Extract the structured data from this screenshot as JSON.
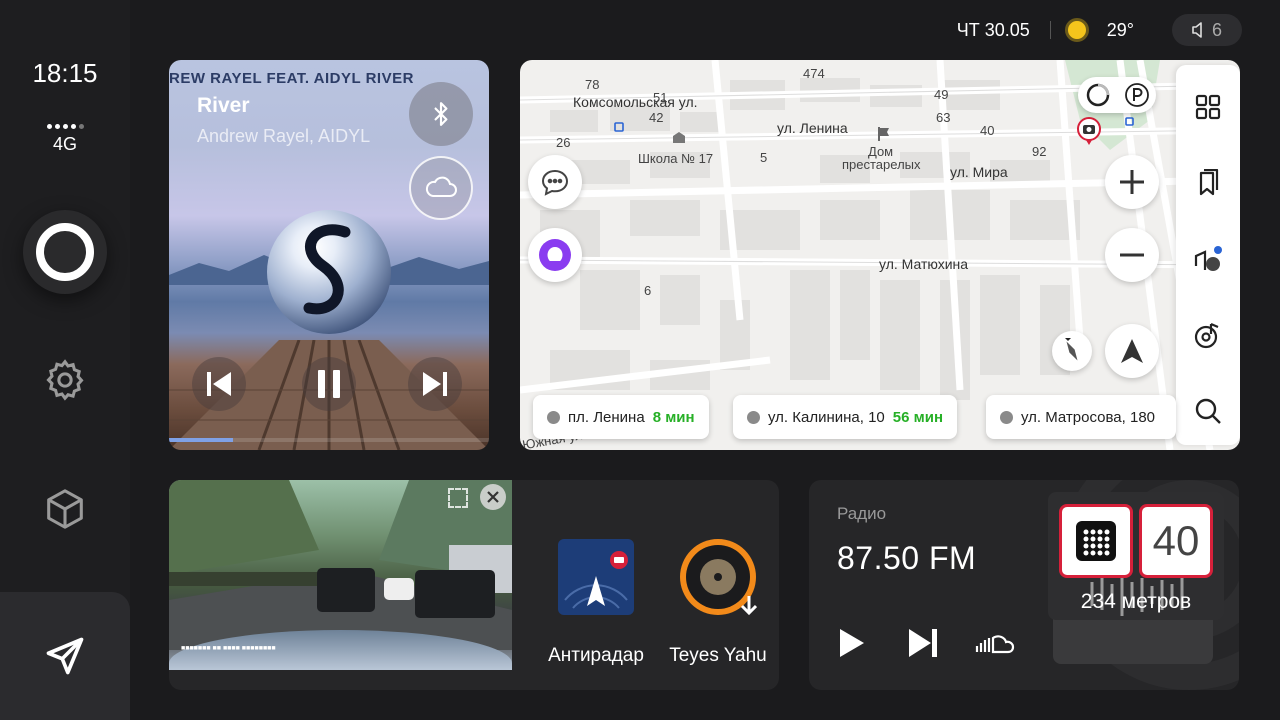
{
  "sidebar": {
    "time": "18:15",
    "network": "4G",
    "icons": [
      "assistant-icon",
      "gear-icon",
      "cube-icon",
      "navigation-arrow-icon"
    ]
  },
  "status_bar": {
    "date": "ЧТ 30.05",
    "weather_icon": "sun-icon",
    "temperature": "29°",
    "volume_level": "6"
  },
  "music": {
    "banner": "REW RAYEL FEAT. AIDYL  RIVER",
    "title": "River",
    "artist": "Andrew Rayel, AIDYL",
    "progress": 0.2,
    "buttons": [
      "bluetooth-icon",
      "cloud-icon",
      "previous-icon",
      "pause-icon",
      "next-icon"
    ]
  },
  "map": {
    "labels": {
      "street_komsomolskaya": "Комсомольская ул.",
      "street_lenina": "ул. Ленина",
      "street_mira": "ул. Мира",
      "street_matyukhina": "ул. Матюхина",
      "school": "Школа № 17",
      "home_line1": "Дом",
      "home_line2": "престарелых",
      "yuzhnaya": "Южная ул.",
      "n78": "78",
      "n51": "51",
      "n42": "42",
      "n26": "26",
      "n5": "5",
      "n6": "6",
      "n63": "63",
      "n40": "40",
      "n92": "92",
      "n49": "49",
      "n474": "474"
    },
    "routes": [
      {
        "place": "пл. Ленина",
        "eta": "8 мин"
      },
      {
        "place": "ул. Калинина, 10",
        "eta": "56 мин"
      },
      {
        "place": "ул. Матросова, 180",
        "eta": ""
      }
    ],
    "side_menu": [
      "grid-icon",
      "bookmark-icon",
      "camera-report-icon",
      "music-icon",
      "search-icon"
    ]
  },
  "apps": [
    {
      "label": "Антирадар",
      "icon": "radar-icon"
    },
    {
      "label": "Teyes Yahu",
      "icon": "vinyl-icon"
    }
  ],
  "radio": {
    "label": "Радио",
    "frequency": "87.50 FM"
  },
  "camera_warning": {
    "speed_limit": "40",
    "distance": "234 метров"
  },
  "colors": {
    "accent_green": "#27b027",
    "alert_red": "#d6203a",
    "sun_yellow": "#f5c51c",
    "assistant_purple": "#8a3cf0"
  }
}
